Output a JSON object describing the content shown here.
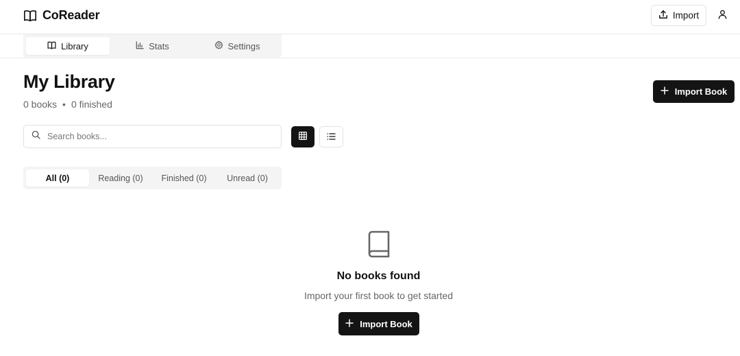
{
  "app": {
    "name": "CoReader"
  },
  "header": {
    "import_label": "Import"
  },
  "nav": {
    "tabs": [
      {
        "label": "Library",
        "icon": "book-open-icon",
        "active": true
      },
      {
        "label": "Stats",
        "icon": "bar-chart-icon",
        "active": false
      },
      {
        "label": "Settings",
        "icon": "gear-icon",
        "active": false
      }
    ]
  },
  "page": {
    "title": "My Library",
    "books_count": "0 books",
    "separator": "•",
    "finished_count": "0 finished",
    "import_book_label": "Import Book"
  },
  "search": {
    "placeholder": "Search books...",
    "value": ""
  },
  "view": {
    "selected": "grid"
  },
  "filters": [
    {
      "label": "All (0)",
      "active": true
    },
    {
      "label": "Reading (0)",
      "active": false
    },
    {
      "label": "Finished (0)",
      "active": false
    },
    {
      "label": "Unread (0)",
      "active": false
    }
  ],
  "empty_state": {
    "icon": "book-icon",
    "title": "No books found",
    "subtitle": "Import your first book to get started",
    "button_label": "Import Book"
  },
  "colors": {
    "primary": "#141414",
    "muted_text": "#666666",
    "tab_bg": "#f4f4f5"
  }
}
